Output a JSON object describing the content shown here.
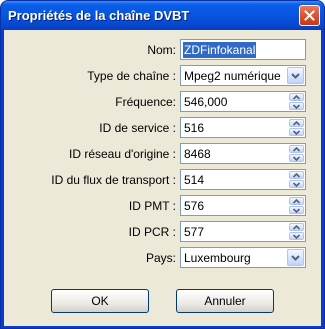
{
  "window": {
    "title": "Propriétés de la chaîne DVBT"
  },
  "fields": {
    "nom": {
      "label": "Nom:",
      "value": "ZDFinfokanal"
    },
    "type": {
      "label": "Type de chaîne :",
      "value": "Mpeg2 numérique"
    },
    "frequence": {
      "label": "Fréquence:",
      "value": "546,000"
    },
    "service_id": {
      "label": "ID de service :",
      "value": "516"
    },
    "network_id": {
      "label": "ID réseau d'origine :",
      "value": "8468"
    },
    "ts_id": {
      "label": "ID du flux de transport :",
      "value": "514"
    },
    "pmt_id": {
      "label": "ID PMT :",
      "value": "576"
    },
    "pcr_id": {
      "label": "ID PCR :",
      "value": "577"
    },
    "pays": {
      "label": "Pays:",
      "value": "Luxembourg"
    }
  },
  "buttons": {
    "ok": "OK",
    "cancel": "Annuler"
  },
  "icons": {
    "close": "close-icon",
    "spin_up": "spin-up-arrow-icon",
    "spin_down": "spin-down-arrow-icon",
    "dropdown": "chevron-down-icon"
  },
  "colors": {
    "titlebar": "#0a5ee8",
    "dialog_bg": "#ece9d8",
    "close_button": "#d8512e",
    "selection": "#316ac5"
  }
}
